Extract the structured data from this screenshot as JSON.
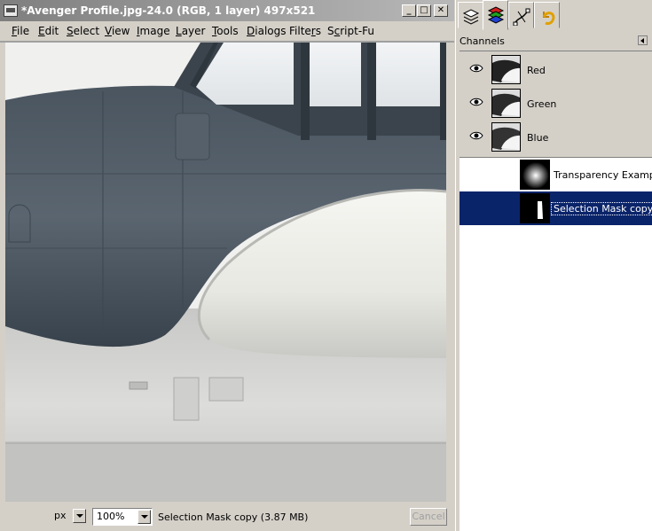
{
  "window": {
    "title": "*Avenger Profile.jpg-24.0 (RGB, 1 layer) 497x521",
    "minimize": "_",
    "maximize": "□",
    "close": "✕"
  },
  "menu": [
    {
      "label": "File",
      "key": "F"
    },
    {
      "label": "Edit",
      "key": "E"
    },
    {
      "label": "Select",
      "key": "S"
    },
    {
      "label": "View",
      "key": "V"
    },
    {
      "label": "Image",
      "key": "I"
    },
    {
      "label": "Layer",
      "key": "L"
    },
    {
      "label": "Tools",
      "key": "T"
    },
    {
      "label": "Dialogs",
      "key": "D"
    },
    {
      "label": "Filters",
      "key": "r"
    },
    {
      "label": "Script-Fu",
      "key": "c"
    }
  ],
  "status": {
    "unit": "px",
    "zoom": "100%",
    "message": "Selection Mask copy (3.87 MB)",
    "cancel": "Cancel"
  },
  "dock": {
    "tabs": [
      "layers-icon",
      "channels-icon",
      "paths-icon",
      "undo-history-icon"
    ],
    "active_tab": "channels-icon",
    "header": "Channels",
    "channels": [
      {
        "name": "Red",
        "visible": true
      },
      {
        "name": "Green",
        "visible": true
      },
      {
        "name": "Blue",
        "visible": true
      }
    ],
    "masks": [
      {
        "name": "Transparency Example",
        "selected": false
      },
      {
        "name": "Selection Mask copy",
        "selected": true
      }
    ]
  },
  "colors": {
    "selection": "#0a246a",
    "titlebar_inactive": "#7f7f7f"
  }
}
